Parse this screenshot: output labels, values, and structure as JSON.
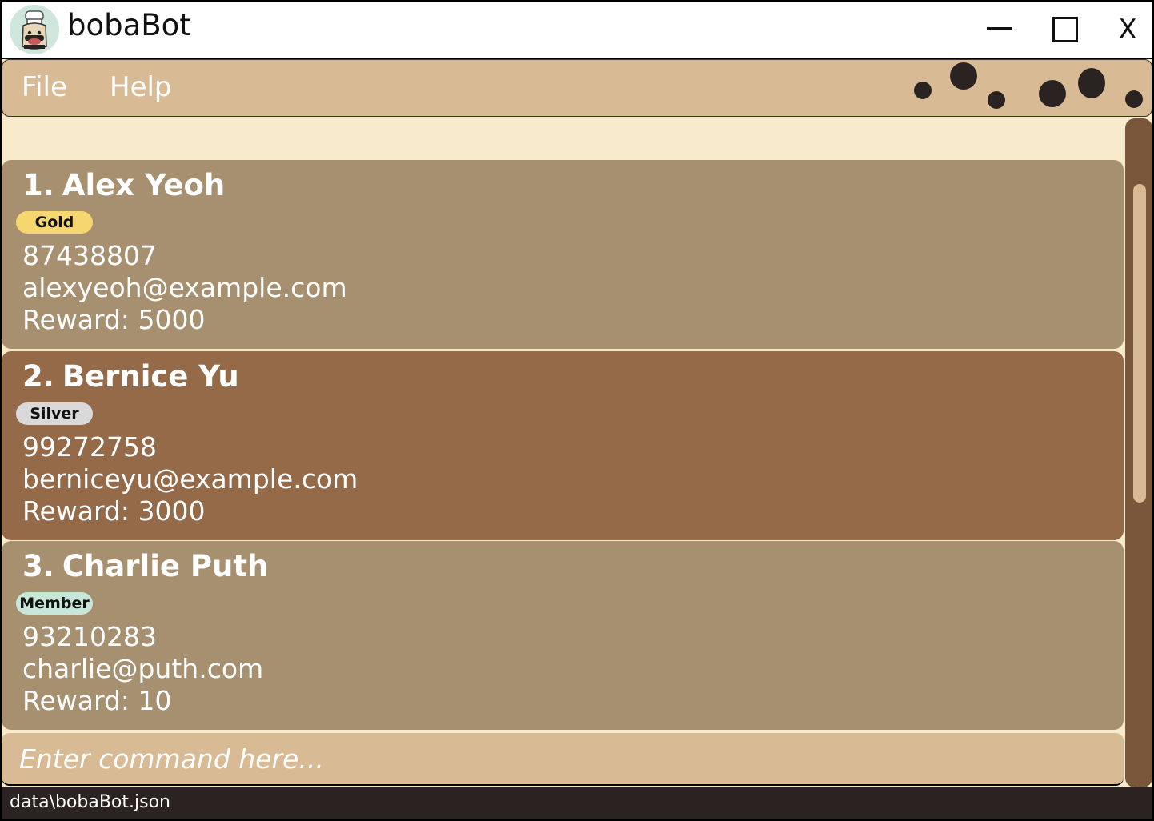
{
  "window": {
    "title": "bobaBot",
    "icons": {
      "app": "boba-chef-icon",
      "minimize": "minimize-icon",
      "maximize": "maximize-icon",
      "close": "close-icon"
    },
    "close_label": "X"
  },
  "menu": {
    "items": [
      {
        "label": "File"
      },
      {
        "label": "Help"
      }
    ]
  },
  "customers": [
    {
      "index": "1.",
      "name": "Alex Yeoh",
      "tier": "Gold",
      "phone": "87438807",
      "email": "alexyeoh@example.com",
      "reward": "Reward: 5000"
    },
    {
      "index": "2.",
      "name": "Bernice Yu",
      "tier": "Silver",
      "phone": "99272758",
      "email": "berniceyu@example.com",
      "reward": "Reward: 3000"
    },
    {
      "index": "3.",
      "name": "Charlie Puth",
      "tier": "Member",
      "phone": "93210283",
      "email": "charlie@puth.com",
      "reward": "Reward: 10"
    }
  ],
  "command": {
    "placeholder": "Enter command here...",
    "value": ""
  },
  "status": {
    "file_path": "data\\bobaBot.json"
  },
  "colors": {
    "background": "#f8ebcb",
    "menu_bar": "#d8ba95",
    "card": "#a6906f",
    "card_selected": "#956a48",
    "scrollbar_track": "#7a563a",
    "status_bar": "#2b2321",
    "gold_badge": "#f5d66f",
    "silver_badge": "#d9d9d9",
    "member_badge": "#c7e7d9"
  }
}
